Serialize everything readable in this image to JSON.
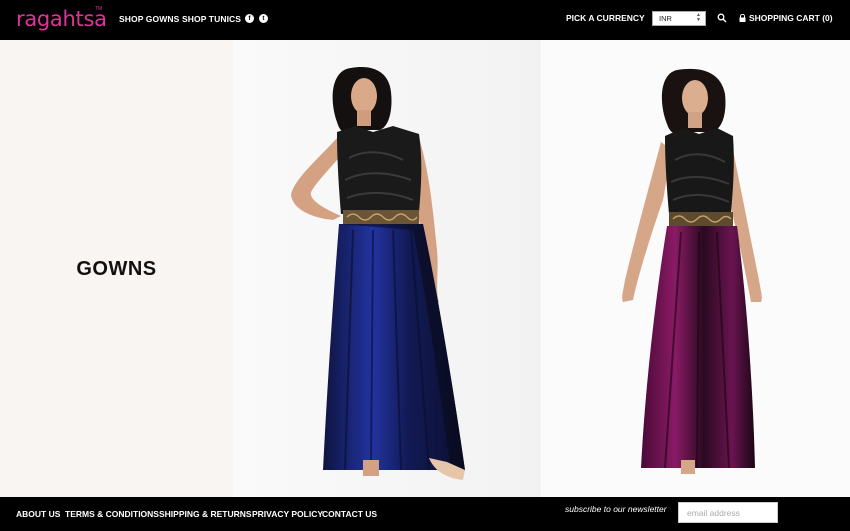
{
  "header": {
    "logo": "ragahtsa",
    "logo_tm": "TM",
    "nav": [
      "SHOP GOWNS",
      "SHOP TUNICS"
    ],
    "social": {
      "facebook": "f",
      "twitter": "t"
    },
    "currency_label": "PICK A CURRENCY",
    "currency_value": "INR",
    "cart_label": "SHOPPING CART (0)"
  },
  "main": {
    "title": "GOWNS"
  },
  "footer": {
    "links": [
      "ABOUT US",
      "TERMS & CONDITIONS",
      "SHIPPING & RETURNS",
      "PRIVACY POLICY",
      "CONTACT US"
    ],
    "newsletter_label": "subscribe to our newsletter",
    "email_placeholder": "email address"
  },
  "colors": {
    "brand": "#e0339a",
    "header_bg": "#000000",
    "side_panel_bg": "#f8f5f3",
    "gown1_skirt": "#1e2a78",
    "gown2_skirt": "#7a1458"
  },
  "icons": [
    "facebook-icon",
    "twitter-icon",
    "search-icon",
    "lock-icon",
    "select-arrows-icon"
  ]
}
